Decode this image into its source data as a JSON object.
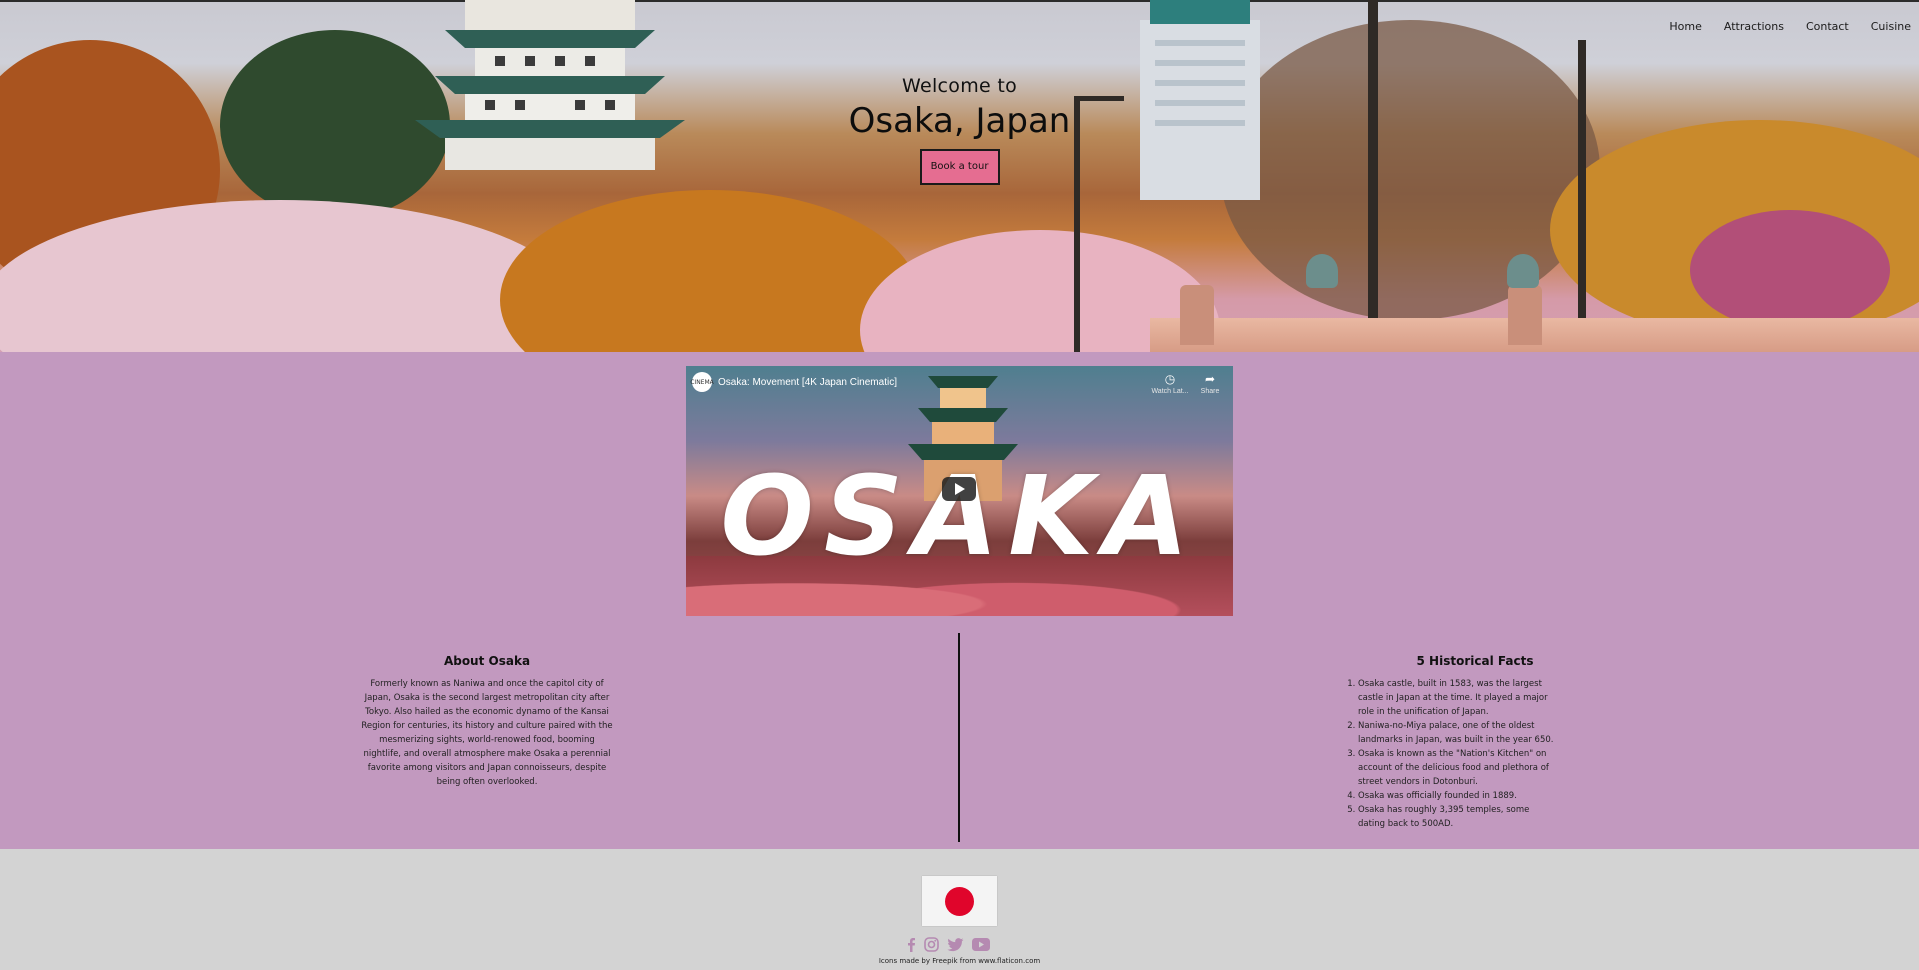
{
  "nav": {
    "items": [
      {
        "label": "Home"
      },
      {
        "label": "Attractions"
      },
      {
        "label": "Contact"
      },
      {
        "label": "Cuisine"
      }
    ]
  },
  "hero": {
    "welcome": "Welcome to",
    "city": "Osaka, Japan",
    "cta": "Book a tour"
  },
  "video": {
    "title": "Osaka: Movement [4K Japan Cinematic]",
    "channel_avatar_text": "CINEMA",
    "overlay_text": "OSAKA",
    "actions": [
      {
        "icon": "clock-icon",
        "label": "Watch Lat..."
      },
      {
        "icon": "share-icon",
        "label": "Share"
      }
    ]
  },
  "about": {
    "title": "About Osaka",
    "text": "Formerly known as Naniwa and once the capitol city of Japan, Osaka is the second largest metropolitan city after Tokyo. Also hailed as the economic dynamo of the Kansai Region for centuries, its history and culture paired with the mesmerizing sights, world-renowed food, booming nightlife, and overall atmosphere make Osaka a perennial favorite among visitors and Japan connoisseurs, despite being often overlooked."
  },
  "facts": {
    "title": "5 Historical Facts",
    "items": [
      "Osaka castle, built in 1583, was the largest castle in Japan at the time. It played a major role in the unification of Japan.",
      "Naniwa-no-Miya palace, one of the oldest landmarks in Japan, was built in the year 650.",
      "Osaka is known as the \"Nation's Kitchen\" on account of the delicious food and plethora of street vendors in Dotonburi.",
      "Osaka was officially founded in 1889.",
      "Osaka has roughly 3,395 temples, some dating back to 500AD."
    ]
  },
  "footer": {
    "social": [
      "facebook-icon",
      "instagram-icon",
      "twitter-icon",
      "youtube-icon"
    ],
    "credit_prefix": "Icons made by ",
    "credit_author": "Freepik",
    "credit_middle": " from ",
    "credit_site": "www.flaticon.com"
  },
  "colors": {
    "main_bg": "#c299bf",
    "footer_bg": "#d3d3d3",
    "cta_bg": "#e56d91",
    "social_icon": "#b58ab1",
    "flag_red": "#e0052b"
  }
}
